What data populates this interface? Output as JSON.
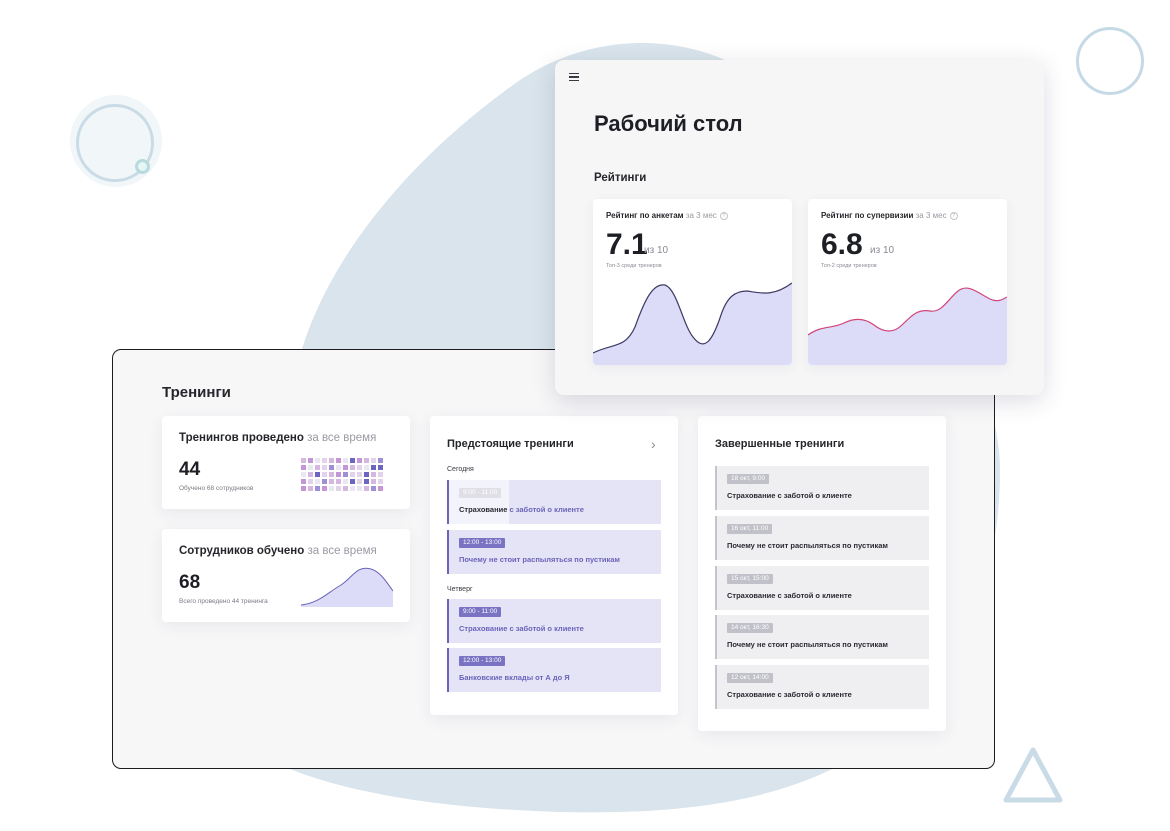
{
  "desktop": {
    "title": "Рабочий стол",
    "ratings_heading": "Рейтинги",
    "rating_cards": [
      {
        "title": "Рейтинг по анкетам",
        "period": "за 3 мес",
        "value": "7.1",
        "of": "из 10",
        "note": "Топ-3 среди тренеров"
      },
      {
        "title": "Рейтинг по супервизии",
        "period": "за 3 мес",
        "value": "6.8",
        "of": "из 10",
        "note": "Топ-2 среди тренеров"
      }
    ]
  },
  "trainings": {
    "heading": "Тренинги",
    "held_card": {
      "title": "Тренингов проведено",
      "period": "за все время",
      "value": "44",
      "note": "Обучено 68 сотрудников"
    },
    "trained_card": {
      "title": "Сотрудников обучено",
      "period": "за все время",
      "value": "68",
      "note": "Всего проведено 44 тренинга"
    },
    "upcoming": {
      "title": "Предстоящие тренинги",
      "days": [
        {
          "label": "Сегодня",
          "items": [
            {
              "time": "9:00 - 11:00",
              "name_start": "Страхование ",
              "name_rest": "с заботой о клиенте"
            },
            {
              "time": "12:00 - 13:00",
              "name_start": "",
              "name_rest": "Почему не стоит распыляться по пустикам"
            }
          ]
        },
        {
          "label": "Четверг",
          "items": [
            {
              "time": "9:00 - 11:00",
              "name_start": "",
              "name_rest": "Страхование с заботой о клиенте"
            },
            {
              "time": "12:00 - 13:00",
              "name_start": "",
              "name_rest": "Банковские вклады от А до Я"
            }
          ]
        }
      ]
    },
    "completed": {
      "title": "Завершенные тренинги",
      "items": [
        {
          "time": "18 окт, 9:00",
          "name": "Страхование с заботой о клиенте"
        },
        {
          "time": "16 окт, 11:00",
          "name": "Почему не стоит распыляться по пустикам"
        },
        {
          "time": "15 окт, 15:00",
          "name": "Страхование с заботой о клиенте"
        },
        {
          "time": "14 окт, 16:30",
          "name": "Почему не стоит распыляться по пустикам"
        },
        {
          "time": "12 окт, 14:00",
          "name": "Страхование с заботой о клиенте"
        }
      ]
    }
  },
  "colors": {
    "accent": "#6b63b8",
    "chart_fill": "#dcdcf8",
    "chart_line_a": "#3e3a63",
    "chart_line_b": "#d2457a",
    "blob": "#d9e4ec"
  },
  "icons": [
    "menu-icon",
    "help-icon",
    "chevron-right-icon",
    "ring-decoration",
    "triangle-decoration"
  ]
}
